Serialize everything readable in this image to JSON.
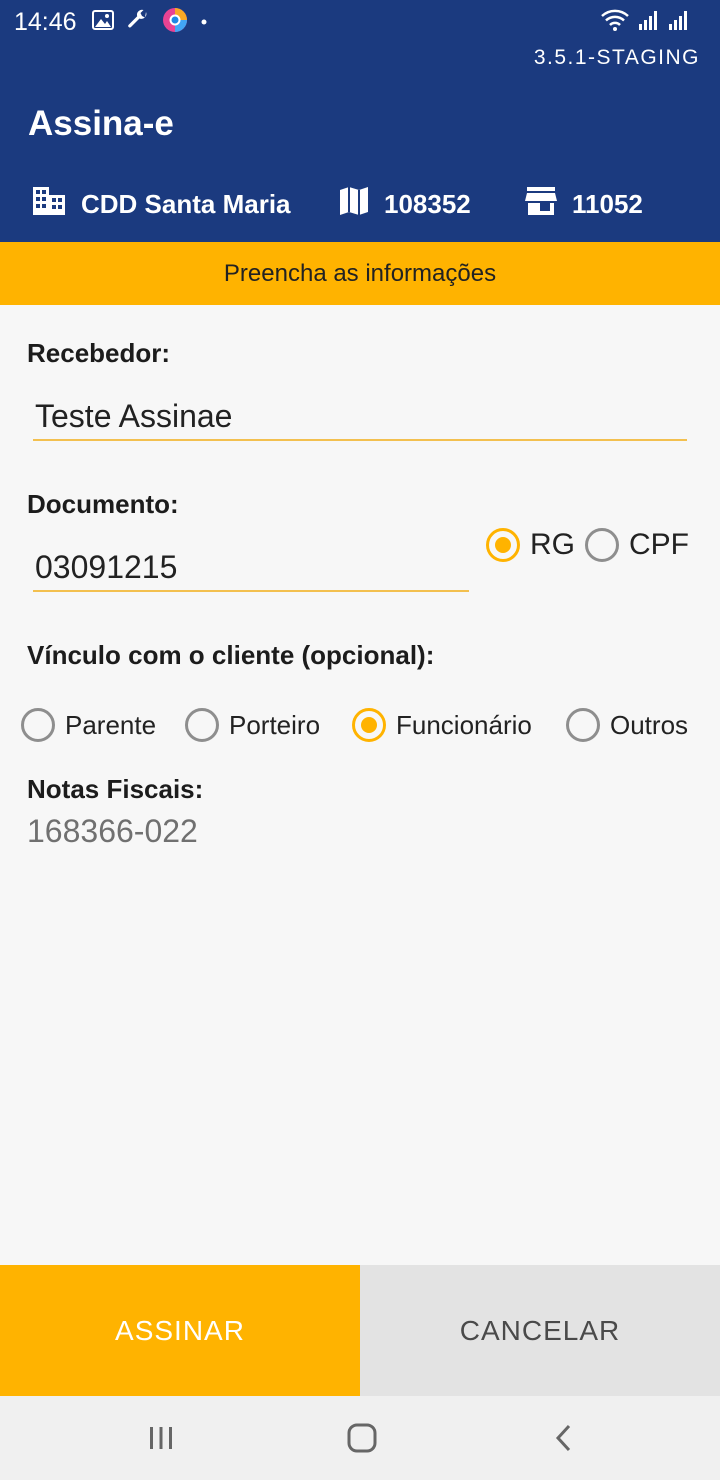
{
  "status_bar": {
    "time": "14:46",
    "icons": [
      "image-icon",
      "wrench-icon",
      "browser-app-icon",
      "dot-icon"
    ],
    "right_icons": [
      "wifi-icon",
      "signal-icon",
      "signal-icon"
    ]
  },
  "header": {
    "version": "3.5.1-STAGING",
    "title": "Assina-e",
    "info": [
      {
        "icon": "building-icon",
        "text": "CDD Santa Maria"
      },
      {
        "icon": "map-icon",
        "text": "108352"
      },
      {
        "icon": "store-icon",
        "text": "11052"
      }
    ],
    "background_color": "#1b3a7f"
  },
  "banner": {
    "text": "Preencha as informações",
    "color": "#ffb300"
  },
  "form": {
    "receiver_label": "Recebedor:",
    "receiver_value": "Teste Assinae",
    "document_label": "Documento:",
    "document_value": "03091215",
    "document_type_options": [
      {
        "label": "RG",
        "checked": true
      },
      {
        "label": "CPF",
        "checked": false
      }
    ],
    "relation_label": "Vínculo com o cliente (opcional):",
    "relation_options": [
      {
        "label": "Parente",
        "checked": false
      },
      {
        "label": "Porteiro",
        "checked": false
      },
      {
        "label": "Funcionário",
        "checked": true
      },
      {
        "label": "Outros",
        "checked": false
      }
    ],
    "invoices_label": "Notas Fiscais:",
    "invoices_value": "168366-022"
  },
  "buttons": {
    "sign": "ASSINAR",
    "cancel": "CANCELAR"
  },
  "nav_bar": {
    "icons": [
      "recent-apps-icon",
      "home-icon",
      "back-icon"
    ]
  }
}
